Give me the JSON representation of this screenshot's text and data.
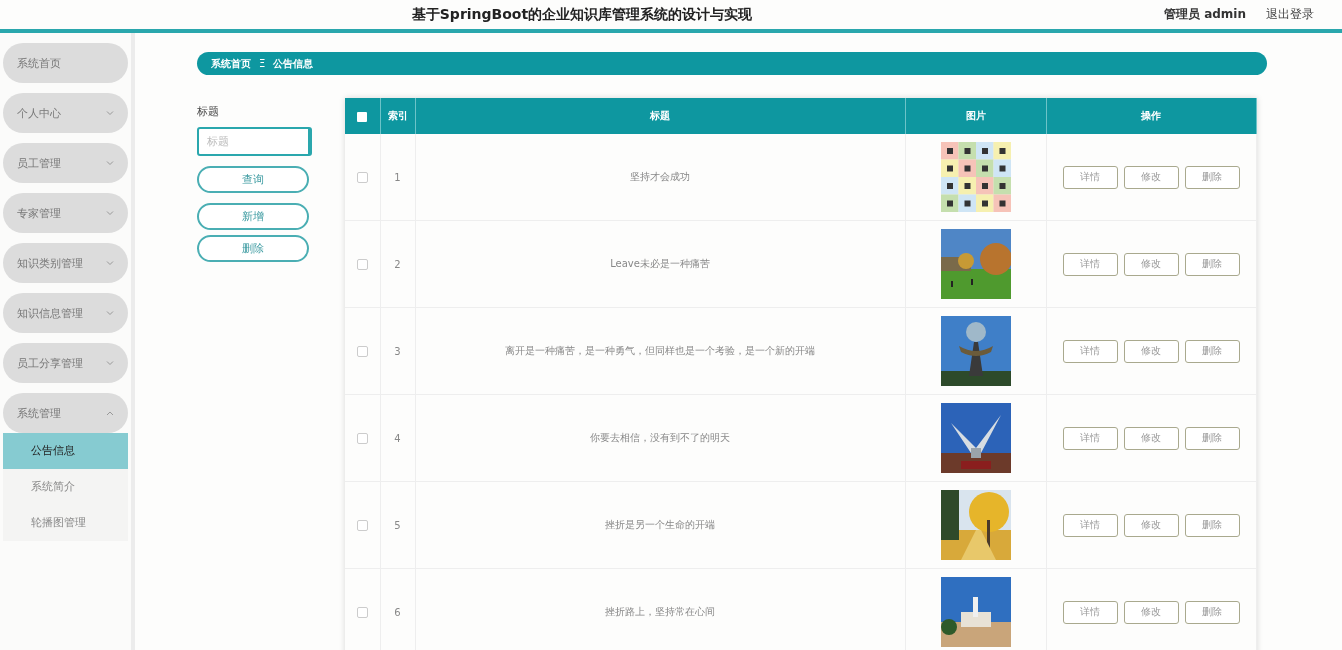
{
  "header": {
    "title": "基于SpringBoot的企业知识库管理系统的设计与实现",
    "user": "管理员 admin",
    "logout": "退出登录"
  },
  "sidebar": {
    "items": [
      {
        "label": "系统首页",
        "kind": "link"
      },
      {
        "label": "个人中心",
        "kind": "group",
        "expanded": false
      },
      {
        "label": "员工管理",
        "kind": "group",
        "expanded": false
      },
      {
        "label": "专家管理",
        "kind": "group",
        "expanded": false
      },
      {
        "label": "知识类别管理",
        "kind": "group",
        "expanded": false
      },
      {
        "label": "知识信息管理",
        "kind": "group",
        "expanded": false
      },
      {
        "label": "员工分享管理",
        "kind": "group",
        "expanded": false
      },
      {
        "label": "系统管理",
        "kind": "group",
        "expanded": true,
        "children": [
          {
            "label": "公告信息",
            "selected": true
          },
          {
            "label": "系统简介",
            "selected": false
          },
          {
            "label": "轮播图管理",
            "selected": false
          }
        ]
      }
    ]
  },
  "breadcrumb": {
    "items": [
      "系统首页",
      "公告信息"
    ],
    "separator": "Ξ"
  },
  "search": {
    "label": "标题",
    "placeholder": "标题",
    "buttons": [
      "查询",
      "新增",
      "删除"
    ]
  },
  "table": {
    "select_all": {
      "checked": false
    },
    "columns": [
      "索引",
      "标题",
      "图片",
      "操作"
    ],
    "rows": [
      {
        "checked": false,
        "index": "1",
        "title": "坚持才会成功",
        "image": {
          "kind": "picture"
        },
        "actions": [
          "详情",
          "修改",
          "删除"
        ]
      },
      {
        "checked": false,
        "index": "2",
        "title": "Leave未必是一种痛苦",
        "image": {
          "kind": "picture"
        },
        "actions": [
          "详情",
          "修改",
          "删除"
        ]
      },
      {
        "checked": false,
        "index": "3",
        "title": "离开是一种痛苦，是一种勇气，但同样也是一个考验，是一个新的开端",
        "image": {
          "kind": "picture"
        },
        "actions": [
          "详情",
          "修改",
          "删除"
        ]
      },
      {
        "checked": false,
        "index": "4",
        "title": "你要去相信，没有到不了的明天",
        "image": {
          "kind": "picture"
        },
        "actions": [
          "详情",
          "修改",
          "删除"
        ]
      },
      {
        "checked": false,
        "index": "5",
        "title": "挫折是另一个生命的开端",
        "image": {
          "kind": "picture"
        },
        "actions": [
          "详情",
          "修改",
          "删除"
        ]
      },
      {
        "checked": false,
        "index": "6",
        "title": "挫折路上，坚持常在心间",
        "image": {
          "kind": "picture"
        },
        "actions": [
          "详情",
          "修改",
          "删除"
        ]
      }
    ]
  }
}
